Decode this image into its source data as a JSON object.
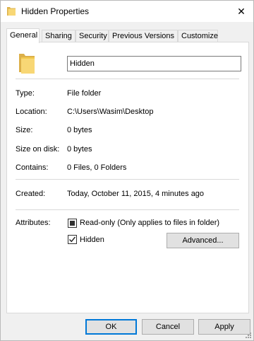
{
  "window": {
    "title": "Hidden Properties",
    "close_glyph": "✕"
  },
  "tabs": [
    {
      "label": "General",
      "active": true
    },
    {
      "label": "Sharing",
      "active": false
    },
    {
      "label": "Security",
      "active": false
    },
    {
      "label": "Previous Versions",
      "active": false
    },
    {
      "label": "Customize",
      "active": false
    }
  ],
  "general": {
    "folder_name": "Hidden",
    "type_label": "Type:",
    "type_value": "File folder",
    "location_label": "Location:",
    "location_value": "C:\\Users\\Wasim\\Desktop",
    "size_label": "Size:",
    "size_value": "0 bytes",
    "size_on_disk_label": "Size on disk:",
    "size_on_disk_value": "0 bytes",
    "contains_label": "Contains:",
    "contains_value": "0 Files, 0 Folders",
    "created_label": "Created:",
    "created_value": "Today, October 11, 2015, 4 minutes ago",
    "attributes_label": "Attributes:",
    "readonly_label": "Read-only (Only applies to files in folder)",
    "readonly_state": "indeterminate",
    "hidden_label": "Hidden",
    "hidden_state": "checked",
    "advanced_button": "Advanced..."
  },
  "footer": {
    "ok": "OK",
    "cancel": "Cancel",
    "apply": "Apply"
  },
  "icons": {
    "title": "folder-icon",
    "large": "folder-icon",
    "close": "close-icon"
  },
  "colors": {
    "accent": "#0078d7",
    "folder": "#f8d775",
    "window_bg": "#f0f0f0",
    "panel_bg": "#ffffff"
  }
}
